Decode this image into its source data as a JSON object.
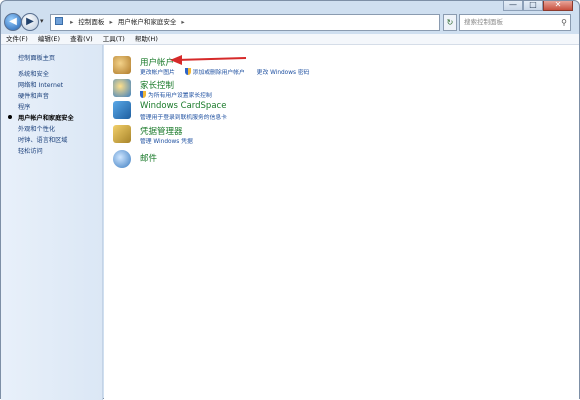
{
  "window": {
    "minimize": "—",
    "maximize": "□",
    "close": "✕"
  },
  "address": {
    "breadcrumb": [
      "控制面板",
      "用户帐户和家庭安全"
    ],
    "search_placeholder": "搜索控制面板"
  },
  "menu": [
    "文件(F)",
    "编辑(E)",
    "查看(V)",
    "工具(T)",
    "帮助(H)"
  ],
  "sidebar": {
    "items": [
      {
        "label": "控制面板主页"
      },
      {
        "label": "系统和安全"
      },
      {
        "label": "网络和 Internet"
      },
      {
        "label": "硬件和声音"
      },
      {
        "label": "程序"
      },
      {
        "label": "用户帐户和家庭安全"
      },
      {
        "label": "外观和个性化"
      },
      {
        "label": "时钟、语言和区域"
      },
      {
        "label": "轻松访问"
      }
    ]
  },
  "categories": [
    {
      "title": "用户帐户",
      "links": [
        "更改帐户图片",
        "添加或删除用户帐户",
        "更改 Windows 密码"
      ],
      "icon": "users-icon"
    },
    {
      "title": "家长控制",
      "links": [
        "为所有用户设置家长控制"
      ],
      "icon": "parental-control-icon"
    },
    {
      "title": "Windows CardSpace",
      "links": [
        "管理用于登录到联机服务的信息卡"
      ],
      "icon": "cardspace-icon"
    },
    {
      "title": "凭据管理器",
      "links": [
        "管理 Windows 凭据"
      ],
      "icon": "credential-manager-icon"
    },
    {
      "title": "邮件",
      "links": [],
      "icon": "mail-icon"
    }
  ],
  "colors": {
    "accent_arrow": "#d62a2a",
    "link_title": "#1a7a2a",
    "link_sub": "#1d4fa0"
  }
}
